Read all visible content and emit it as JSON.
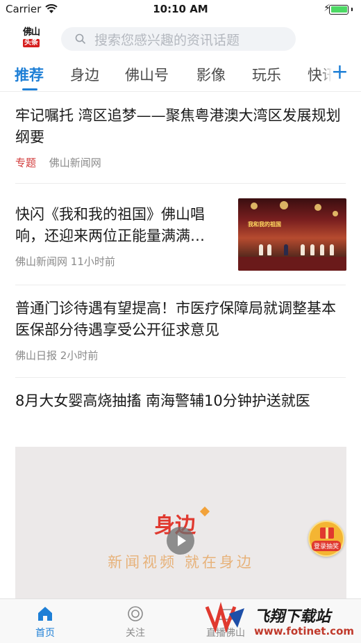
{
  "status_bar": {
    "carrier": "Carrier",
    "time": "10:10 AM"
  },
  "header": {
    "logo_top": "佛山",
    "logo_bottom": "头条",
    "search_placeholder": "搜索您感兴趣的资讯话题"
  },
  "tabs": [
    {
      "label": "推荐",
      "active": true
    },
    {
      "label": "身边"
    },
    {
      "label": "佛山号"
    },
    {
      "label": "影像"
    },
    {
      "label": "玩乐"
    },
    {
      "label": "快讯"
    }
  ],
  "add_tab_label": "+",
  "news": [
    {
      "title": "牢记嘱托 湾区追梦——聚焦粤港澳大湾区发展规划纲要",
      "tag": "专题",
      "source": "佛山新闻网",
      "time": ""
    },
    {
      "title": "快闪《我和我的祖国》佛山唱响，还迎来两位正能量满满…",
      "tag": "",
      "source": "佛山新闻网",
      "time": "11小时前",
      "thumb_caption": "我和我的祖国"
    },
    {
      "title": "普通门诊待遇有望提高！市医疗保障局就调整基本医保部分待遇享受公开征求意见",
      "tag": "",
      "source": "佛山日报",
      "time": "2小时前"
    },
    {
      "title": "8月大女婴高烧抽搐 南海警辅10分钟护送就医"
    }
  ],
  "video": {
    "logo": "身边",
    "slogan": "新闻视频 就在身边"
  },
  "gift": {
    "label": "登录抽奖"
  },
  "bottom_nav": [
    {
      "label": "首页",
      "active": true,
      "icon": "home-icon"
    },
    {
      "label": "关注",
      "icon": "follow-icon"
    },
    {
      "label": "直播佛山",
      "icon": "live-icon"
    }
  ],
  "watermark": {
    "text": "飞翔下载站",
    "url": "www.fotinet.com"
  },
  "colors": {
    "accent": "#1e7fd6",
    "tag": "#d23a3a",
    "meta": "#8a8a8a"
  }
}
